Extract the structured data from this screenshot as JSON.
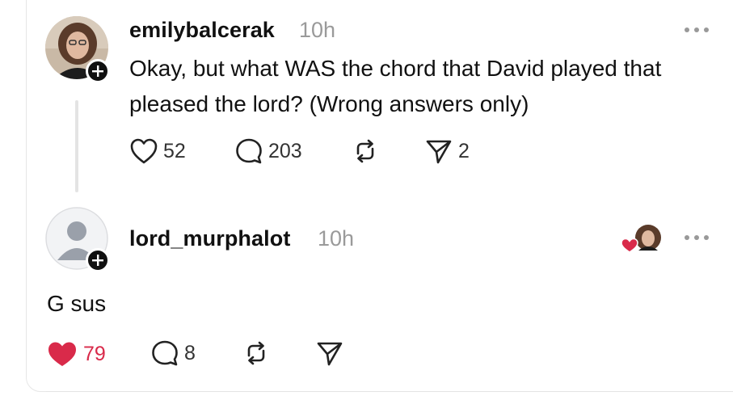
{
  "post": {
    "username": "emilybalcerak",
    "time": "10h",
    "text_line1": "Okay, but what WAS the chord that David played that",
    "text_line2": "pleased the lord? (Wrong answers only)",
    "likes": "52",
    "replies": "203",
    "shares": "2"
  },
  "reply": {
    "username": "lord_murphalot",
    "time": "10h",
    "text": "G sus",
    "likes": "79",
    "replies": "8",
    "liked": true
  },
  "colors": {
    "like_red": "#d92a4a",
    "muted_text": "#9a9a9a"
  },
  "icons": [
    "heart-icon",
    "comment-icon",
    "repost-icon",
    "send-icon",
    "more-icon",
    "plus-icon"
  ]
}
